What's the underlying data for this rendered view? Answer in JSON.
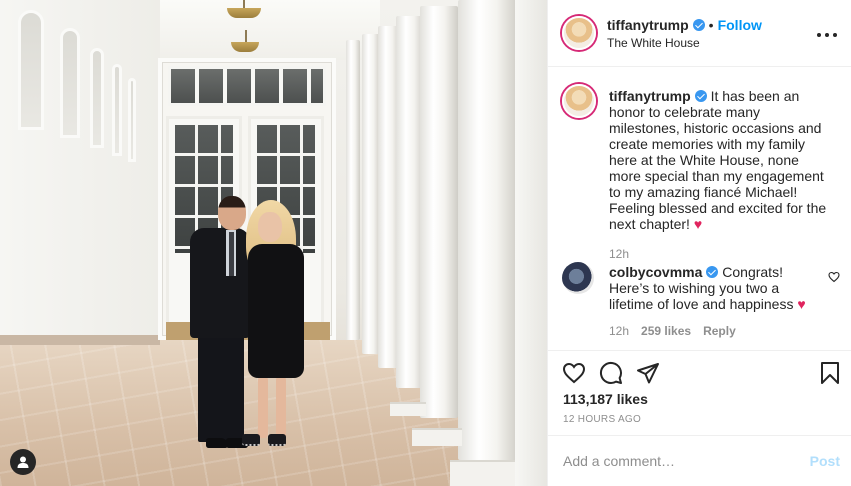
{
  "header": {
    "username": "tiffanytrump",
    "separator": "•",
    "follow_label": "Follow",
    "location": "The White House",
    "more_icon": "ellipsis-icon"
  },
  "caption": {
    "username": "tiffanytrump",
    "text": "It has been an honor to celebrate many milestones, historic occasions and create memories with my family here at the White House, none more special than my engagement to my amazing fiancé Michael! Feeling blessed and excited for the next chapter!",
    "emoji": "♥",
    "time": "12h"
  },
  "comment": {
    "username": "colbycovmma",
    "text": "Congrats! Here’s to wishing you two a lifetime of love and happiness",
    "emoji": "♥",
    "time": "12h",
    "likes": "259 likes",
    "reply_label": "Reply"
  },
  "actions": {
    "icons": [
      "heart-icon",
      "comment-icon",
      "share-icon",
      "bookmark-icon"
    ],
    "likes": "113,187 likes",
    "posted": "12 HOURS AGO"
  },
  "add_comment": {
    "placeholder": "Add a comment…",
    "post_label": "Post"
  },
  "colors": {
    "accent": "#0095f6",
    "verified": "#3897f0",
    "muted": "#8e8e8e",
    "heart": "#e0245e",
    "post_disabled": "#b2dffc"
  }
}
